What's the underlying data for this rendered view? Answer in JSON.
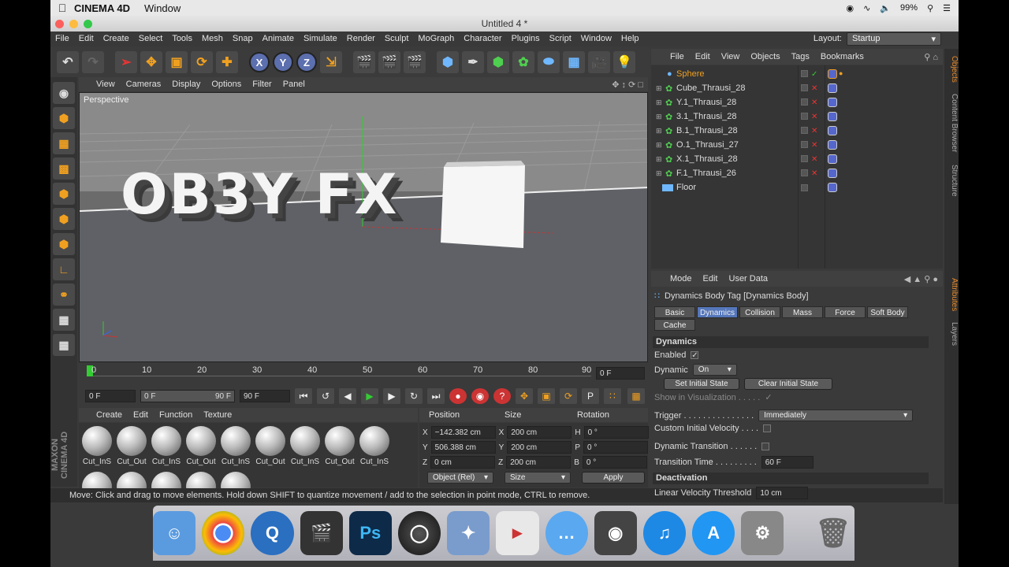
{
  "macmenu": {
    "app": "CINEMA 4D",
    "window": "Window",
    "battery": "99%"
  },
  "window": {
    "title": "Untitled 4 *"
  },
  "menubar": {
    "items": [
      "File",
      "Edit",
      "Create",
      "Select",
      "Tools",
      "Mesh",
      "Snap",
      "Animate",
      "Simulate",
      "Render",
      "Sculpt",
      "MoGraph",
      "Character",
      "Plugins",
      "Script",
      "Window",
      "Help"
    ],
    "layout_label": "Layout:",
    "layout_value": "Startup"
  },
  "viewport": {
    "menu": [
      "View",
      "Cameras",
      "Display",
      "Options",
      "Filter",
      "Panel"
    ],
    "label": "Perspective",
    "scene_text": "OB3Y FX"
  },
  "timeline": {
    "ticks": [
      "0",
      "10",
      "20",
      "30",
      "40",
      "50",
      "60",
      "70",
      "80",
      "90"
    ],
    "current_frame": "0 F"
  },
  "transport": {
    "start": "0 F",
    "range_start": "0 F",
    "range_end": "90 F",
    "end": "90 F"
  },
  "materials": {
    "menu": [
      "Create",
      "Edit",
      "Function",
      "Texture"
    ],
    "row1": [
      "Cut_InS",
      "Cut_Out",
      "Cut_InS",
      "Cut_Out",
      "Cut_InS",
      "Cut_Out",
      "Cut_InS",
      "Cut_Out",
      "Cut_InS"
    ]
  },
  "coordinates": {
    "headers": [
      "Position",
      "Size",
      "Rotation"
    ],
    "rows": [
      {
        "axis": "X",
        "pos": "−142.382 cm",
        "saxis": "X",
        "size": "200 cm",
        "raxis": "H",
        "rot": "0 °"
      },
      {
        "axis": "Y",
        "pos": "506.388 cm",
        "saxis": "Y",
        "size": "200 cm",
        "raxis": "P",
        "rot": "0 °"
      },
      {
        "axis": "Z",
        "pos": "0 cm",
        "saxis": "Z",
        "size": "200 cm",
        "raxis": "B",
        "rot": "0 °"
      }
    ],
    "mode": "Object (Rel)",
    "size_mode": "Size",
    "apply": "Apply"
  },
  "status": "Move: Click and drag to move elements. Hold down SHIFT to quantize movement / add to the selection in point mode, CTRL to remove.",
  "objects": {
    "menu": [
      "File",
      "Edit",
      "View",
      "Objects",
      "Tags",
      "Bookmarks"
    ],
    "items": [
      {
        "name": "Sphere",
        "selected": true
      },
      {
        "name": "Cube_Thrausi_28"
      },
      {
        "name": "Y.1_Thrausi_28"
      },
      {
        "name": "3.1_Thrausi_28"
      },
      {
        "name": "B.1_Thrausi_28"
      },
      {
        "name": "O.1_Thrausi_27"
      },
      {
        "name": "X.1_Thrausi_28"
      },
      {
        "name": "F.1_Thrausi_26"
      },
      {
        "name": "Floor"
      }
    ]
  },
  "sidetabs": {
    "objects": "Objects",
    "content": "Content Browser",
    "structure": "Structure",
    "attributes": "Attributes",
    "layers": "Layers"
  },
  "attributes": {
    "menu": [
      "Mode",
      "Edit",
      "User Data"
    ],
    "title": "Dynamics Body Tag [Dynamics Body]",
    "tabs": [
      "Basic",
      "Dynamics",
      "Collision",
      "Mass",
      "Force",
      "Soft Body",
      "Cache"
    ],
    "section_dynamics": "Dynamics",
    "enabled": "Enabled",
    "dynamic": "Dynamic",
    "dynamic_value": "On",
    "set_initial": "Set Initial State",
    "clear_initial": "Clear Initial State",
    "show_vis": "Show in Visualization . . . . .",
    "trigger": "Trigger . . . . . . . . . . . . . . .",
    "trigger_value": "Immediately",
    "custom_vel": "Custom Initial Velocity . . . .",
    "dyn_trans": "Dynamic Transition . . . . . .",
    "trans_time": "Transition Time . . . . . . . . .",
    "trans_time_value": "60 F",
    "section_deact": "Deactivation",
    "lin_vel": "Linear Velocity Threshold",
    "lin_vel_value": "10 cm"
  }
}
